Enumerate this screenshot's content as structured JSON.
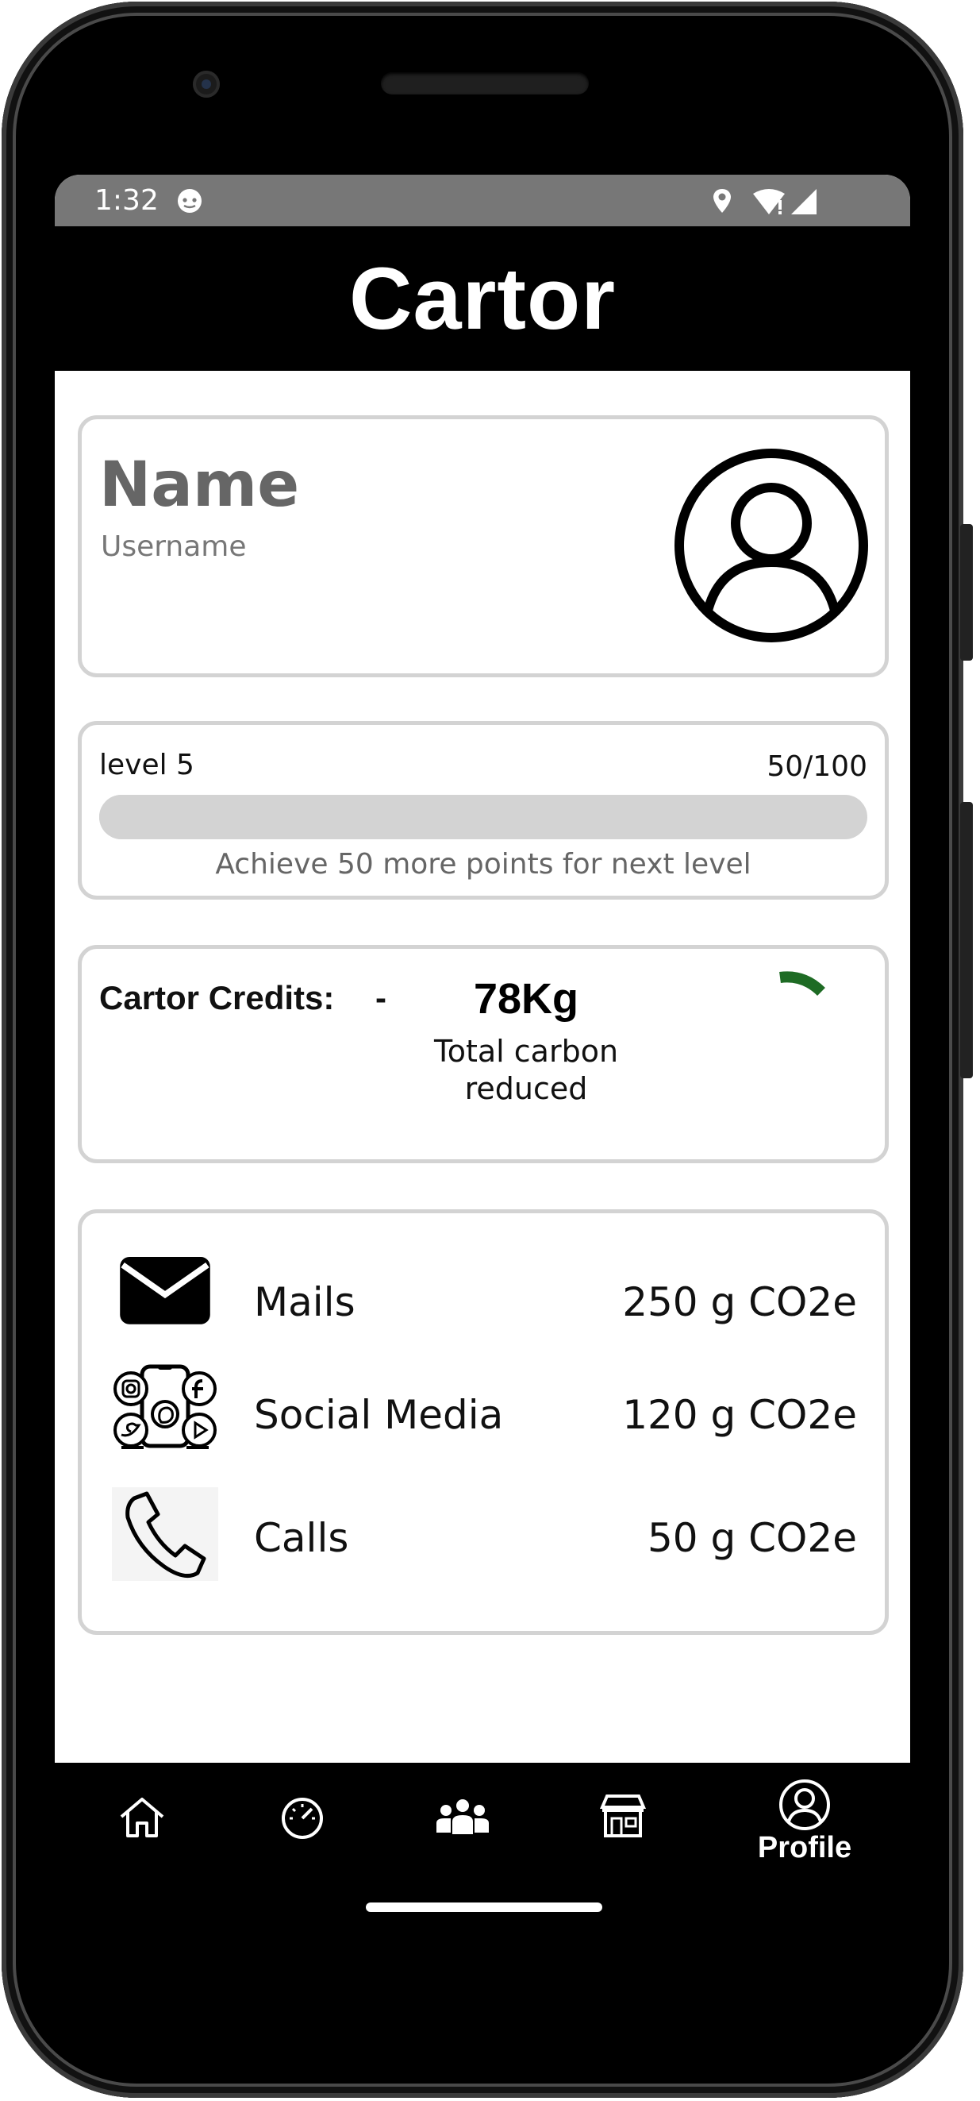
{
  "status_bar": {
    "time": "1:32",
    "face_icon": "android-face-icon",
    "icons": [
      "location-icon",
      "wifi-icon",
      "signal-icon"
    ]
  },
  "app_bar": {
    "title": "Cartor"
  },
  "profile": {
    "name": "Name",
    "username": "Username",
    "avatar_icon": "user-circle-icon"
  },
  "level": {
    "label": "level 5",
    "count": "50/100",
    "progress_fraction": 0.5,
    "hint": "Achieve 50 more points for next level"
  },
  "credits": {
    "label": "Cartor Credits:",
    "value": "-",
    "carbon_value": "78Kg",
    "carbon_caption_line1": "Total carbon",
    "carbon_caption_line2": "reduced",
    "gauge_color": "#1e6b24"
  },
  "emissions": [
    {
      "icon": "mail-icon",
      "label": "Mails",
      "value": "250 g CO2e"
    },
    {
      "icon": "social-media-icon",
      "label": "Social Media",
      "value": "120 g CO2e"
    },
    {
      "icon": "phone-icon",
      "label": "Calls",
      "value": "50 g CO2e"
    }
  ],
  "bottom_nav": {
    "items": [
      {
        "icon": "home-icon",
        "label": ""
      },
      {
        "icon": "speedometer-icon",
        "label": ""
      },
      {
        "icon": "community-icon",
        "label": ""
      },
      {
        "icon": "store-icon",
        "label": ""
      },
      {
        "icon": "profile-icon",
        "label": "Profile",
        "active": true
      }
    ]
  },
  "colors": {
    "frame": "#000000",
    "status_bar": "#777777",
    "card_border": "#d3d3d3",
    "progress_track": "#d3d3d3",
    "accent_green": "#1e6b24"
  }
}
